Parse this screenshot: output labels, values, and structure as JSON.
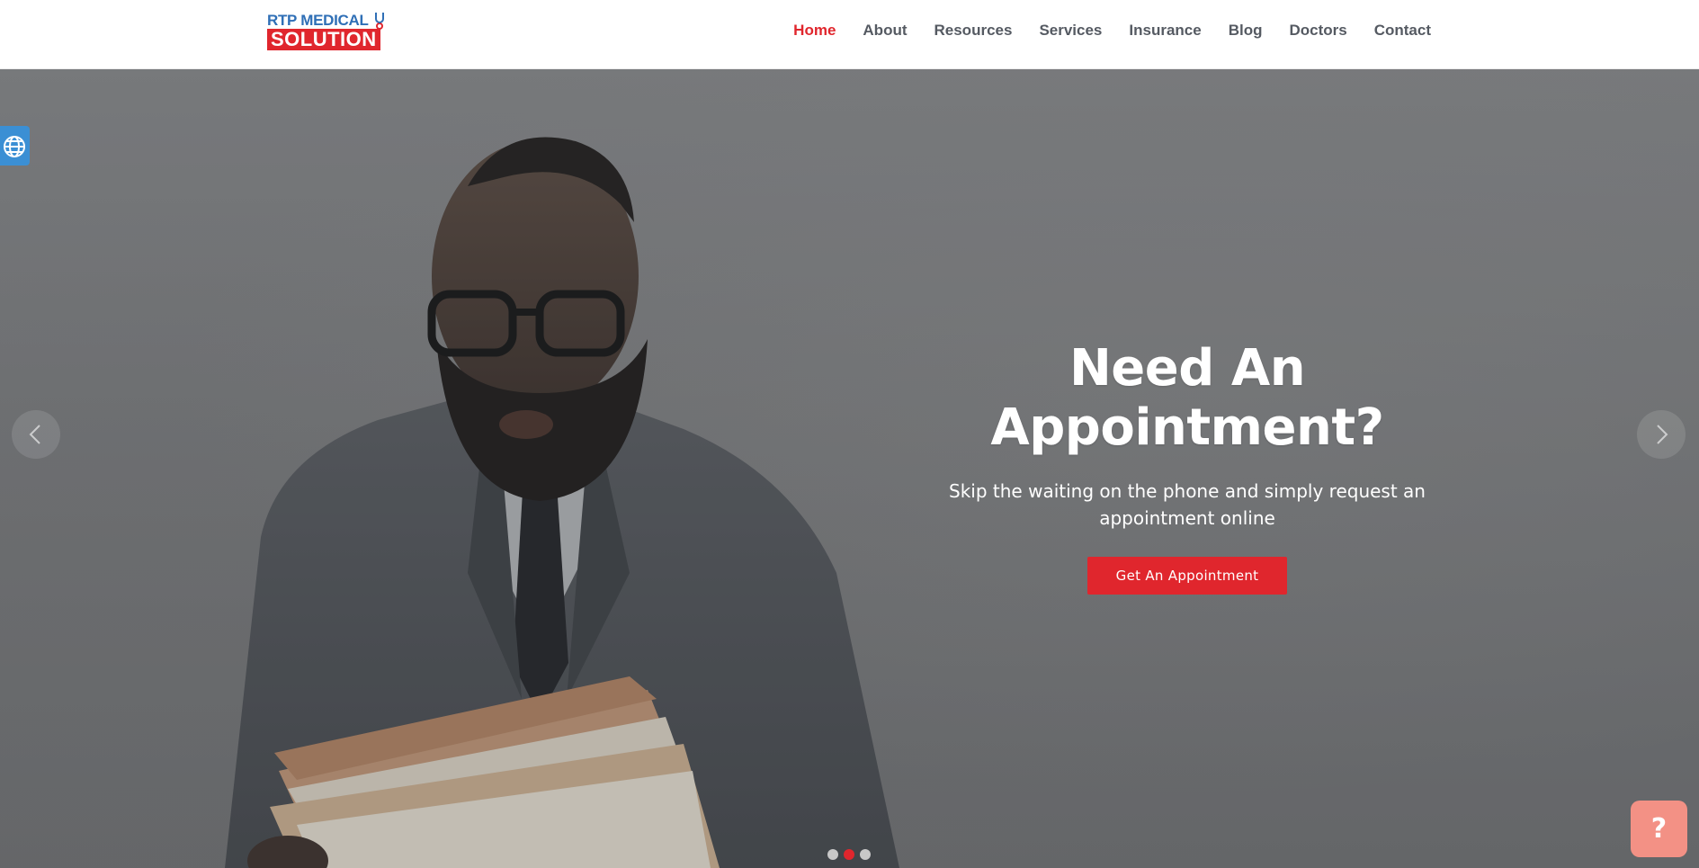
{
  "brand": {
    "logo_top": "RTP MEDICAL",
    "logo_bottom": "SOLUTION",
    "logo_colors": {
      "blue": "#2f6fb6",
      "red": "#e0262d"
    }
  },
  "nav": {
    "items": [
      {
        "label": "Home",
        "active": true
      },
      {
        "label": "About",
        "active": false
      },
      {
        "label": "Resources",
        "active": false
      },
      {
        "label": "Services",
        "active": false
      },
      {
        "label": "Insurance",
        "active": false
      },
      {
        "label": "Blog",
        "active": false
      },
      {
        "label": "Doctors",
        "active": false
      },
      {
        "label": "Contact",
        "active": false
      }
    ]
  },
  "hero": {
    "title_line1": "Need An",
    "title_line2": "Appointment?",
    "subtitle": "Skip the waiting on the phone and simply request an appointment online",
    "cta_label": "Get An Appointment",
    "slides": 3,
    "active_slide": 2
  },
  "widgets": {
    "help_label": "?",
    "globe_icon": "globe-icon",
    "prev_icon": "chevron-left-icon",
    "next_icon": "chevron-right-icon"
  },
  "colors": {
    "accent": "#e0262d",
    "nav_text": "#555a62",
    "help_button": "#f39185",
    "globe_button": "#3b8fd4"
  }
}
